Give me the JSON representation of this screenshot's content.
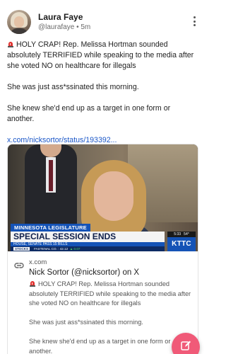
{
  "author": {
    "name": "Laura Faye",
    "handle": "@laurafaye",
    "separator": "•",
    "time": "5m"
  },
  "post": {
    "paragraph1": "HOLY CRAP! Rep. Melissa Hortman sounded absolutely TERRIFIED while speaking to the media after she voted NO on healthcare for illegals",
    "paragraph2": "She was just ass*ssinated this morning.",
    "paragraph3": "She knew she'd end up as a target in one form or another.",
    "link": "x.com/nicksortor/status/193392..."
  },
  "card": {
    "video": {
      "tag": "MINNESOTA LEGISLATURE",
      "headline": "SPECIAL SESSION ENDS",
      "subline": "HOUSE, SENATE PASS 15 BILLS",
      "ticker_tag": "STOCKS",
      "ticker_text": "FASTENAL CO. : 42.12",
      "ticker_change": "▲ 0.07",
      "time": "5:33",
      "temp": "54°",
      "station": "KTTC"
    },
    "domain": "x.com",
    "title": "Nick Sortor (@nicksortor) on X",
    "text1": "HOLY CRAP! Rep. Melissa Hortman sounded absolutely TERRIFIED while speaking to the media after she voted NO on healthcare for illegals",
    "text2": "She was just ass*ssinated this morning.",
    "text3": "She knew she'd end up as a target in one form or another."
  },
  "colors": {
    "link": "#1a56c7",
    "fab": "#f05a78",
    "news_blue": "#1553b6"
  },
  "icons": [
    "kebab-menu-icon",
    "siren-icon",
    "link-icon",
    "edit-icon"
  ]
}
